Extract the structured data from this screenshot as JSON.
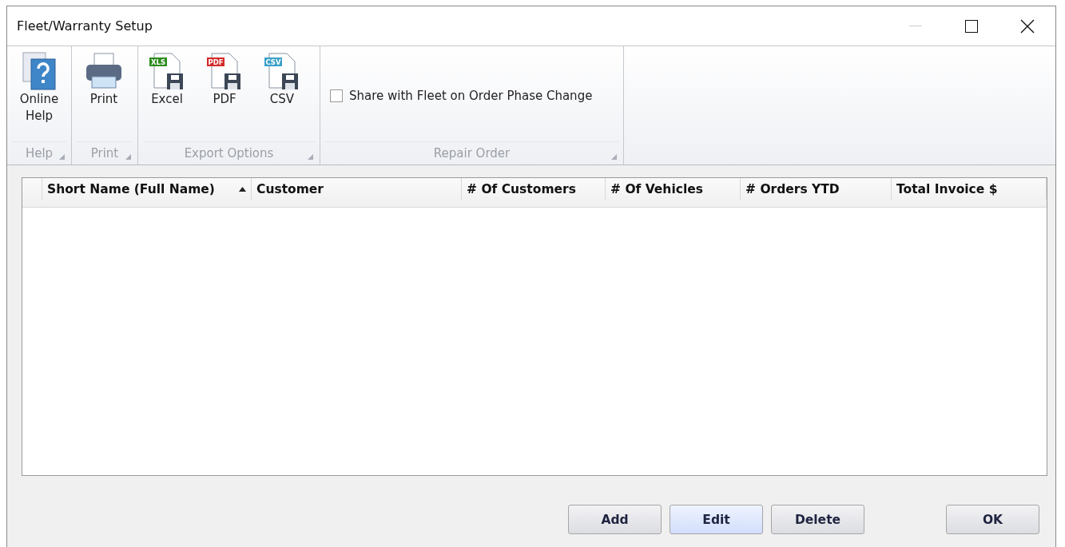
{
  "window": {
    "title": "Fleet/Warranty Setup"
  },
  "ribbon": {
    "groups": [
      {
        "label": "Help",
        "items": [
          {
            "kind": "help",
            "label": "Online Help"
          }
        ]
      },
      {
        "label": "Print",
        "items": [
          {
            "kind": "print",
            "label": "Print"
          }
        ]
      },
      {
        "label": "Export Options",
        "items": [
          {
            "kind": "export",
            "badge": "XLS",
            "color": "#2e8b1e",
            "label": "Excel"
          },
          {
            "kind": "export",
            "badge": "PDF",
            "color": "#d42a2a",
            "label": "PDF"
          },
          {
            "kind": "export",
            "badge": "CSV",
            "color": "#3aa0c8",
            "label": "CSV"
          }
        ]
      },
      {
        "label": "Repair Order",
        "items": [
          {
            "kind": "checkbox",
            "label": "Share with Fleet on Order Phase Change",
            "checked": false
          }
        ]
      }
    ]
  },
  "table": {
    "columns": [
      {
        "label": "Short Name (Full Name)",
        "sorted": true
      },
      {
        "label": "Customer"
      },
      {
        "label": "# Of Customers"
      },
      {
        "label": "# Of Vehicles"
      },
      {
        "label": "# Orders YTD"
      },
      {
        "label": "Total Invoice $"
      }
    ]
  },
  "buttons": [
    {
      "label": "Add",
      "highlighted": false
    },
    {
      "label": "Edit",
      "highlighted": true
    },
    {
      "label": "Delete",
      "highlighted": false
    },
    {
      "label": "OK",
      "highlighted": false
    }
  ]
}
